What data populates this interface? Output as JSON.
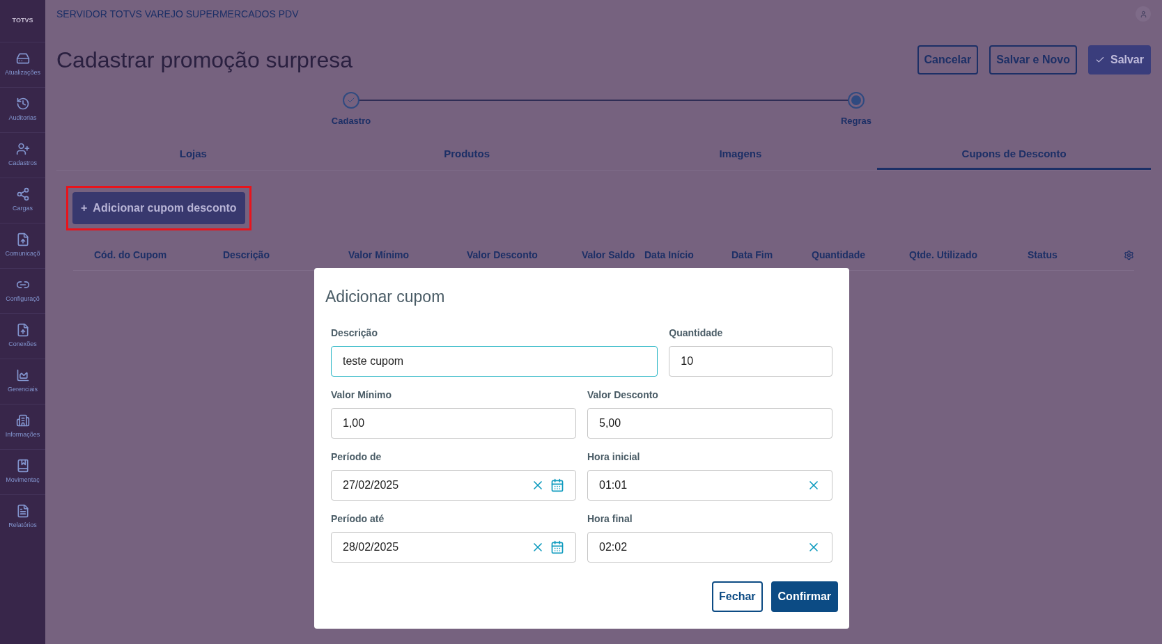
{
  "sidebar": {
    "logo": "TOTVS",
    "items": [
      {
        "kind": "server",
        "label": "Atualizações"
      },
      {
        "kind": "history",
        "label": "Auditorias"
      },
      {
        "kind": "user-plus",
        "label": "Cadastros"
      },
      {
        "kind": "share",
        "label": "Cargas"
      },
      {
        "kind": "file-up",
        "label": "Comunicaçõ"
      },
      {
        "kind": "link",
        "label": "Configuraçõ"
      },
      {
        "kind": "file-up",
        "label": "Conexões"
      },
      {
        "kind": "chart",
        "label": "Gerenciais"
      },
      {
        "kind": "building",
        "label": "Informações"
      },
      {
        "kind": "book",
        "label": "Movimentaç"
      },
      {
        "kind": "file",
        "label": "Relatórios"
      }
    ]
  },
  "header": {
    "system": "SERVIDOR TOTVS VAREJO SUPERMERCADOS PDV"
  },
  "page": {
    "title": "Cadastrar promoção surpresa",
    "actions": [
      {
        "kind": "outline",
        "label": "Cancelar"
      },
      {
        "kind": "outline",
        "label": "Salvar e Novo"
      },
      {
        "kind": "primary",
        "label": "Salvar"
      }
    ]
  },
  "stepper": [
    {
      "label": "Cadastro",
      "kind": "done"
    },
    {
      "label": "Regras",
      "kind": "current"
    }
  ],
  "tabs": [
    {
      "label": "Lojas",
      "selected": false
    },
    {
      "label": "Produtos",
      "selected": false
    },
    {
      "label": "Imagens",
      "selected": false
    },
    {
      "label": "Cupons de Desconto",
      "selected": true
    }
  ],
  "add_button": {
    "icon": "+",
    "label": "Adicionar cupom desconto",
    "highlighted": true
  },
  "table": {
    "columns": [
      "Cód. do Cupom",
      "Descrição",
      "Valor Mínimo",
      "Valor Desconto",
      "Valor Saldo",
      "Data Início",
      "Data Fim",
      "Quantidade",
      "Qtde. Utilizado",
      "Status"
    ]
  },
  "dialog": {
    "title": "Adicionar cupom",
    "rows": [
      [
        {
          "label": "Descrição",
          "value": "teste cupom",
          "kind": "text",
          "focused": true
        },
        {
          "label": "Quantidade",
          "value": "10",
          "kind": "text",
          "focused": false
        }
      ],
      [
        {
          "label": "Valor Mínimo",
          "value": "1,00",
          "kind": "text",
          "focused": false
        },
        {
          "label": "Valor Desconto",
          "value": "5,00",
          "kind": "text",
          "focused": false
        }
      ],
      [
        {
          "label": "Período de",
          "value": "27/02/2025",
          "kind": "date",
          "focused": false
        },
        {
          "label": "Hora inicial",
          "value": "01:01",
          "kind": "time",
          "focused": false
        }
      ],
      [
        {
          "label": "Período até",
          "value": "28/02/2025",
          "kind": "date",
          "focused": false
        },
        {
          "label": "Hora final",
          "value": "02:02",
          "kind": "time",
          "focused": false
        }
      ]
    ],
    "buttons": [
      {
        "kind": "outline",
        "label": "Fechar"
      },
      {
        "kind": "primary",
        "label": "Confirmar"
      }
    ]
  }
}
